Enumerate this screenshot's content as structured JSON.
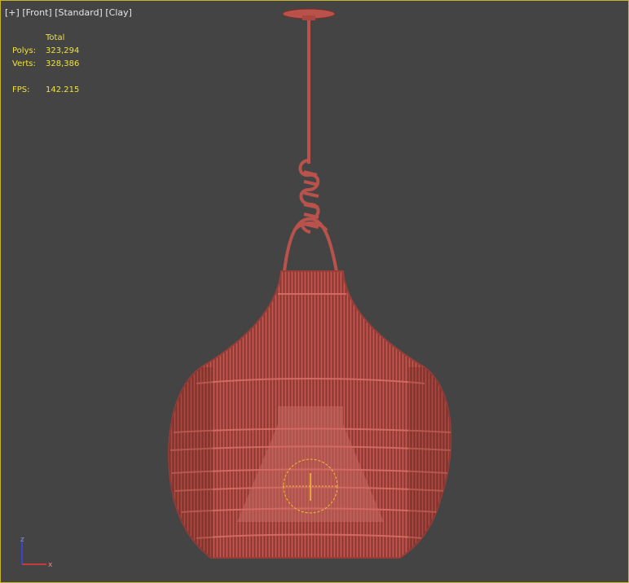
{
  "viewport": {
    "menu": {
      "plus": "[+]",
      "view": "[Front]",
      "shading": "[Standard]",
      "style": "[Clay]"
    },
    "stats": {
      "header": "Total",
      "polys_label": "Polys:",
      "polys_value": "323,294",
      "verts_label": "Verts:",
      "verts_value": "328,386",
      "fps_label": "FPS:",
      "fps_value": "142.215"
    },
    "colors": {
      "background": "#444444",
      "border": "#c8b428",
      "stats_text": "#f0e23a",
      "model": "#b9524a",
      "model_dark": "#7a2c28",
      "gizmo_z": "#3a46c8",
      "gizmo_x": "#c83a3a",
      "selection": "#f0c030"
    },
    "gizmo": {
      "z_label": "z",
      "x_label": "x"
    },
    "object": "wicker-pendant-lamp"
  }
}
